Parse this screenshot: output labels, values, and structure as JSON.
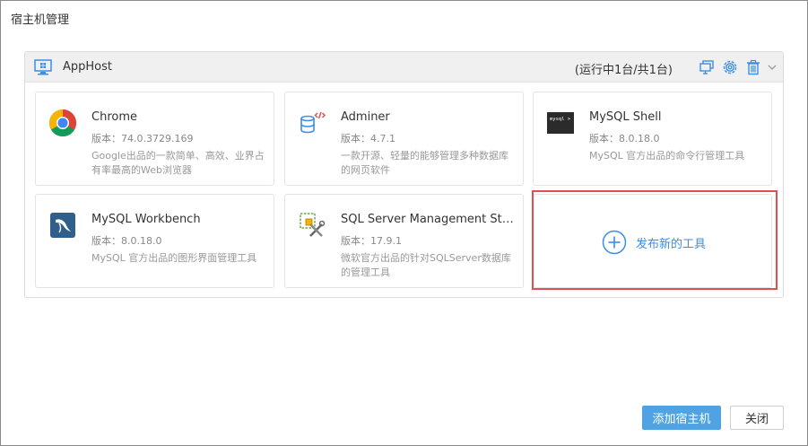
{
  "dialog": {
    "title": "宿主机管理"
  },
  "host": {
    "name": "AppHost",
    "status": "(运行中1台/共1台)"
  },
  "tools": [
    {
      "name": "Chrome",
      "version": "版本：74.0.3729.169",
      "desc": "Google出品的一款简单、高效、业界占有率最高的Web浏览器"
    },
    {
      "name": "Adminer",
      "version": "版本：4.7.1",
      "desc": "一款开源、轻量的能够管理多种数据库的网页软件"
    },
    {
      "name": "MySQL Shell",
      "version": "版本：8.0.18.0",
      "desc": "MySQL 官方出品的命令行管理工具"
    },
    {
      "name": "MySQL Workbench",
      "version": "版本：8.0.18.0",
      "desc": "MySQL 官方出品的图形界面管理工具"
    },
    {
      "name": "SQL Server Management Stu...",
      "version": "版本：17.9.1",
      "desc": "微软官方出品的针对SQLServer数据库的管理工具"
    }
  ],
  "publish": {
    "label": "发布新的工具"
  },
  "buttons": {
    "add_host": "添加宿主机",
    "close": "关闭"
  },
  "colors": {
    "accent": "#4fa3e3",
    "highlight": "#e05050",
    "link": "#3a8ee6"
  },
  "icons": {
    "host": "monitor-windows-icon",
    "remote": "remote-desktop-icon",
    "settings": "gear-icon",
    "delete": "trash-icon",
    "collapse": "chevron-down-icon",
    "publish": "plus-circle-icon"
  }
}
